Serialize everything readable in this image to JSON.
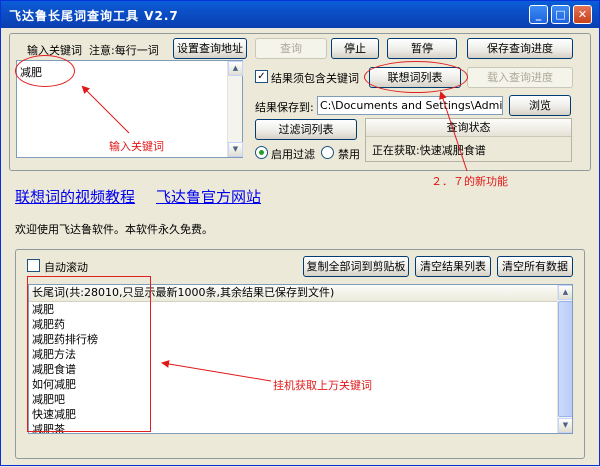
{
  "window": {
    "title": "飞达鲁长尾词查询工具 V2.7",
    "minimize_glyph": "_",
    "maximize_glyph": "□",
    "close_glyph": "✕"
  },
  "keywords": {
    "label": "输入关键词",
    "hint": "注意:每行一词",
    "text": "减肥"
  },
  "buttons": {
    "settings": "设置查询地址",
    "query": "查询",
    "stop": "停止",
    "pause": "暂停",
    "save_progress": "保存查询进度",
    "related_list": "联想词列表",
    "load_progress": "载入查询进度",
    "browse": "浏览",
    "filter_list": "过滤词列表",
    "copy_all": "复制全部词到剪贴板",
    "clear_results": "清空结果列表",
    "clear_all": "清空所有数据"
  },
  "options": {
    "must_contain_label": "结果须包含关键词",
    "must_contain_checked": true,
    "save_to_label": "结果保存到:",
    "save_path": "C:\\Documents and Settings\\Administrator\\桌",
    "enable_filter": "启用过滤",
    "disable_filter": "禁用",
    "filter_mode": "enable",
    "auto_scroll": "自动滚动",
    "auto_scroll_checked": false
  },
  "status": {
    "title": "查询状态",
    "text": "正在获取:快速减肥食谱"
  },
  "links": {
    "video_tutorial": "联想词的视频教程",
    "official_site": "飞达鲁官方网站"
  },
  "welcome": "欢迎使用飞达鲁软件。本软件永久免费。",
  "results": {
    "header": "长尾词(共:28010,只显示最新1000条,其余结果已保存到文件)",
    "items": [
      "减肥",
      "减肥药",
      "减肥药排行榜",
      "减肥方法",
      "减肥食谱",
      "如何减肥",
      "减肥吧",
      "快速减肥",
      "减肥茶"
    ]
  },
  "annotations": {
    "input_keyword": "输入关键词",
    "new_feature": "２．７的新功能",
    "bulk_keywords": "挂机获取上万关键词",
    "color": "#e01818"
  }
}
